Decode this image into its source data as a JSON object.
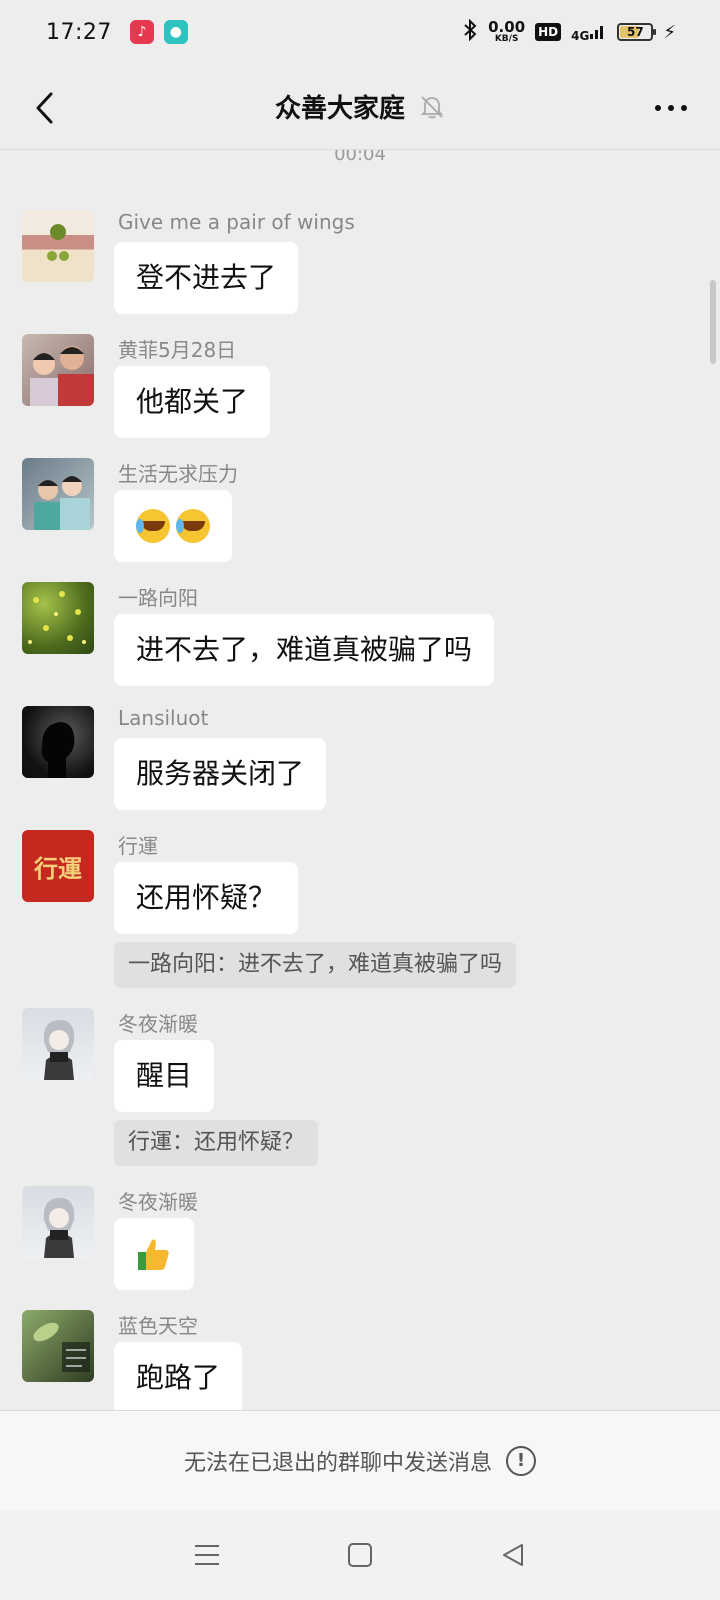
{
  "status_bar": {
    "time": "17:27",
    "net_speed": "0.00",
    "net_unit": "KB/S",
    "hd": "HD",
    "network": "4G",
    "battery": "57",
    "battery_level": 0.57
  },
  "header": {
    "title": "众善大家庭"
  },
  "timestamp": "00:04",
  "messages": [
    {
      "sender": "Give me a pair of wings",
      "text": "登不进去了"
    },
    {
      "sender": "黄菲5月28日",
      "text": "他都关了"
    },
    {
      "sender": "生活无求压力",
      "text": "",
      "emojis": [
        "facepalm-emoji",
        "facepalm-emoji"
      ]
    },
    {
      "sender": "一路向阳",
      "text": "进不去了，难道真被骗了吗"
    },
    {
      "sender": "Lansiluot",
      "text": "服务器关闭了"
    },
    {
      "sender": "行運",
      "text": "还用怀疑？",
      "quote": "一路向阳：进不去了，难道真被骗了吗",
      "avatar_text": "行運"
    },
    {
      "sender": "冬夜渐暖",
      "text": "醒目",
      "quote": "行運：还用怀疑？"
    },
    {
      "sender": "冬夜渐暖",
      "text": "",
      "emojis": [
        "thumbs-up-emoji"
      ]
    },
    {
      "sender": "蓝色天空",
      "text": "跑路了"
    }
  ],
  "notice": {
    "text": "无法在已退出的群聊中发送消息"
  },
  "colors": {
    "background": "#ededed",
    "bubble": "#ffffff",
    "quote": "#e0e0e0"
  }
}
